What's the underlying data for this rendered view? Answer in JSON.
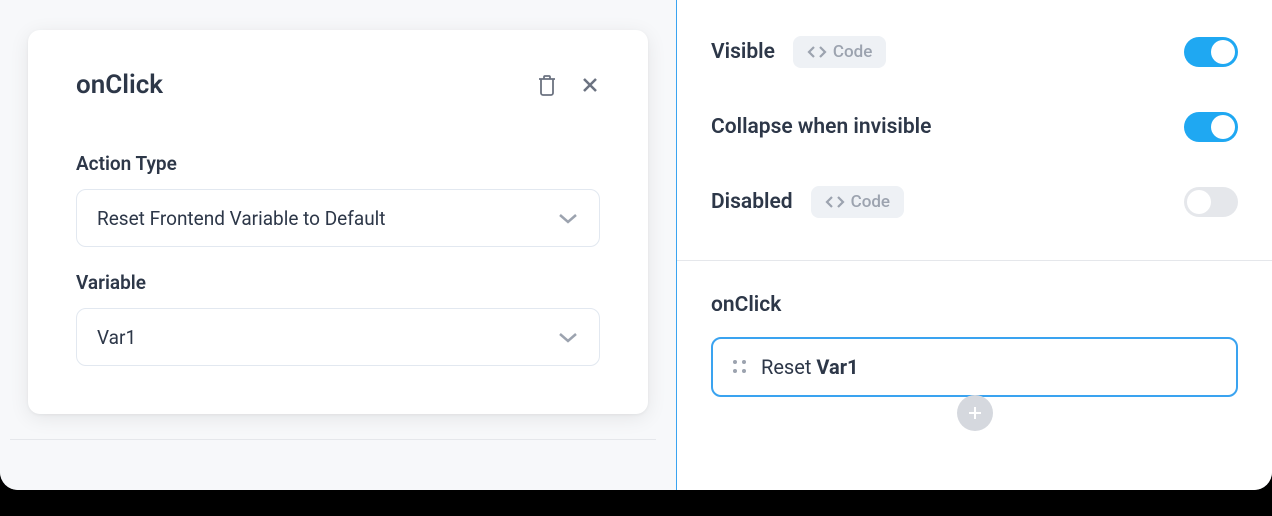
{
  "popup": {
    "title": "onClick",
    "fields": {
      "action_type": {
        "label": "Action Type",
        "value": "Reset Frontend Variable to Default"
      },
      "variable": {
        "label": "Variable",
        "value": "Var1"
      }
    }
  },
  "properties": {
    "visible": {
      "label": "Visible",
      "code_badge": "Code",
      "enabled": true
    },
    "collapse": {
      "label": "Collapse when invisible",
      "enabled": true
    },
    "disabled": {
      "label": "Disabled",
      "code_badge": "Code",
      "enabled": false
    }
  },
  "events": {
    "section_title": "onClick",
    "items": [
      {
        "prefix": "Reset ",
        "bold": "Var1"
      }
    ]
  }
}
